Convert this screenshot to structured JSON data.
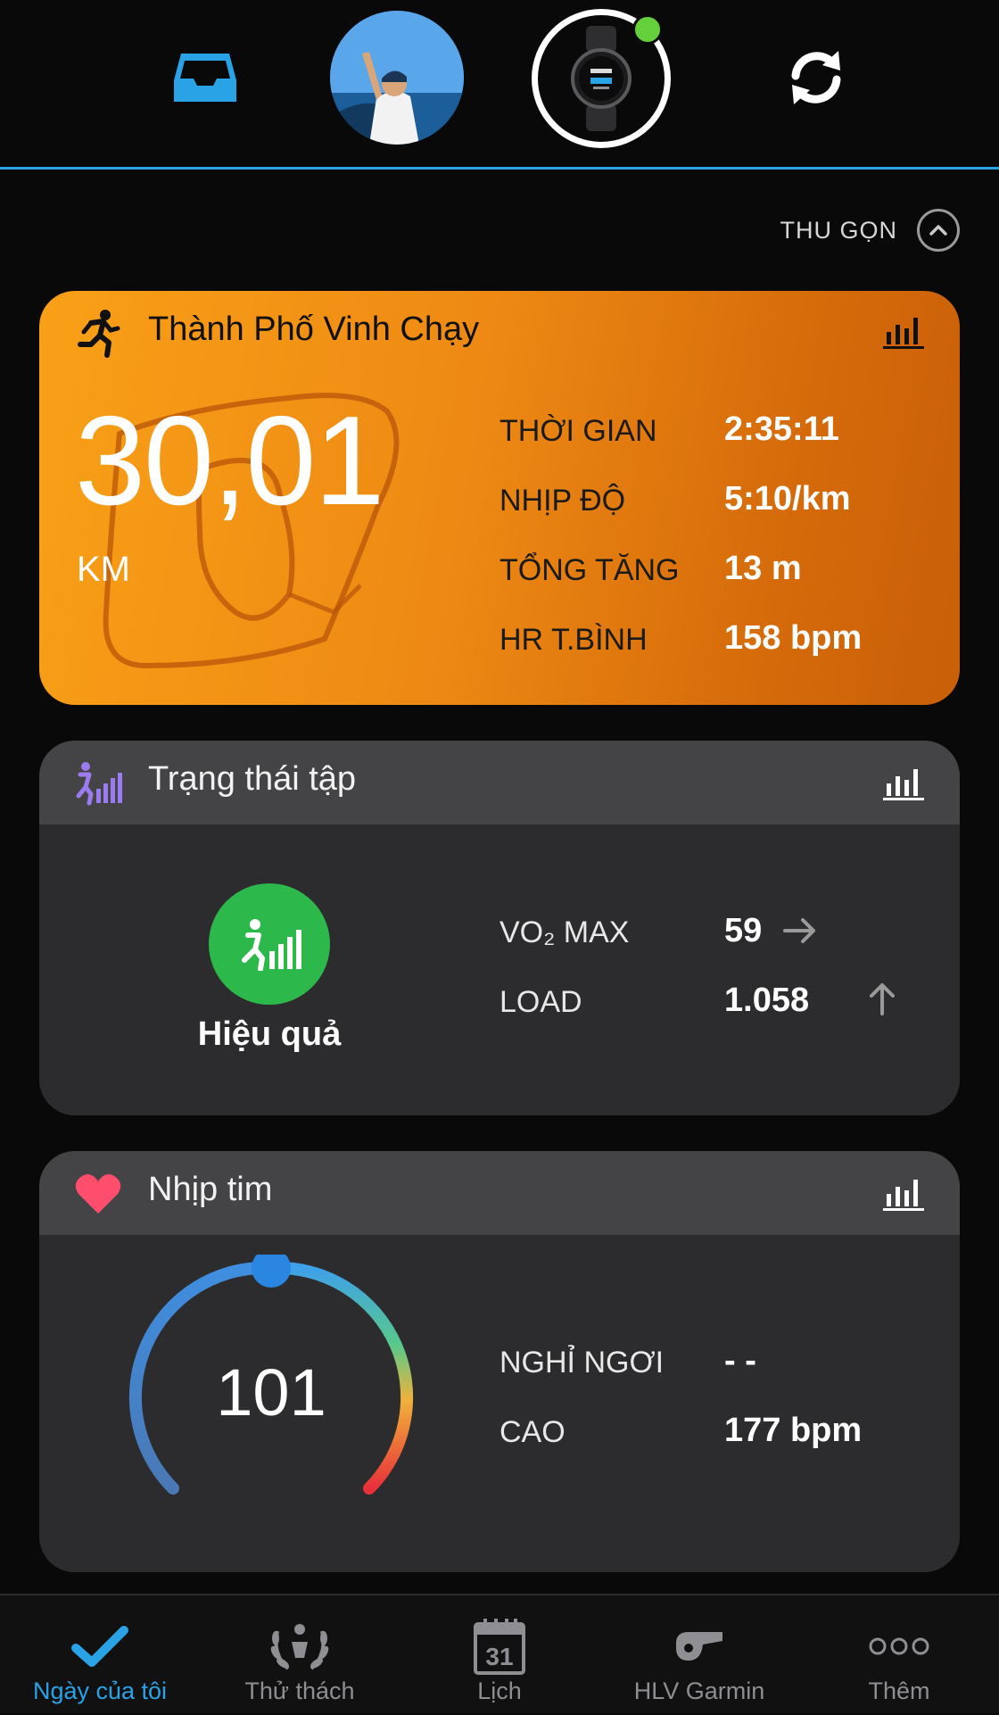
{
  "topbar": {
    "icons": [
      "inbox-icon",
      "avatar",
      "watch-device-icon",
      "sync-icon"
    ],
    "device_status_color": "#64d13c",
    "accent_color": "#2aa3e6"
  },
  "collapse": {
    "label": "THU GỌN",
    "icon": "chevron-up-icon"
  },
  "activity_card": {
    "title": "Thành Phố Vinh Chạy",
    "icon": "running-icon",
    "distance": "30,01",
    "distance_unit": "KM",
    "stats": [
      {
        "label": "THỜI GIAN",
        "value": "2:35:11"
      },
      {
        "label": "NHỊP ĐỘ",
        "value": "5:10/km"
      },
      {
        "label": "TỔNG TĂNG",
        "value": "13 m"
      },
      {
        "label": "HR T.BÌNH",
        "value": "158 bpm"
      }
    ],
    "color": "#f29012"
  },
  "training_card": {
    "title": "Trạng thái tập",
    "icon": "training-status-icon",
    "status": "Hiệu quả",
    "status_color": "#2db84c",
    "vo2_label": "VO₂ MAX",
    "vo2_value": "59",
    "vo2_trend": "arrow-right-icon",
    "load_label": "LOAD",
    "load_value": "1.058",
    "load_trend": "arrow-up-icon"
  },
  "heart_card": {
    "title": "Nhịp tim",
    "icon": "heart-icon",
    "current": "101",
    "resting_label": "NGHỈ NGƠI",
    "resting_value": "- -",
    "high_label": "CAO",
    "high_value": "177 bpm",
    "heart_color": "#ff4d6d"
  },
  "tabs": [
    {
      "label": "Ngày của tôi",
      "icon": "checkmark-icon",
      "active": true
    },
    {
      "label": "Thử thách",
      "icon": "laurel-icon",
      "active": false
    },
    {
      "label": "Lịch",
      "icon": "calendar-icon",
      "day": "31",
      "active": false
    },
    {
      "label": "HLV Garmin",
      "icon": "whistle-icon",
      "active": false
    },
    {
      "label": "Thêm",
      "icon": "more-icon",
      "active": false
    }
  ]
}
